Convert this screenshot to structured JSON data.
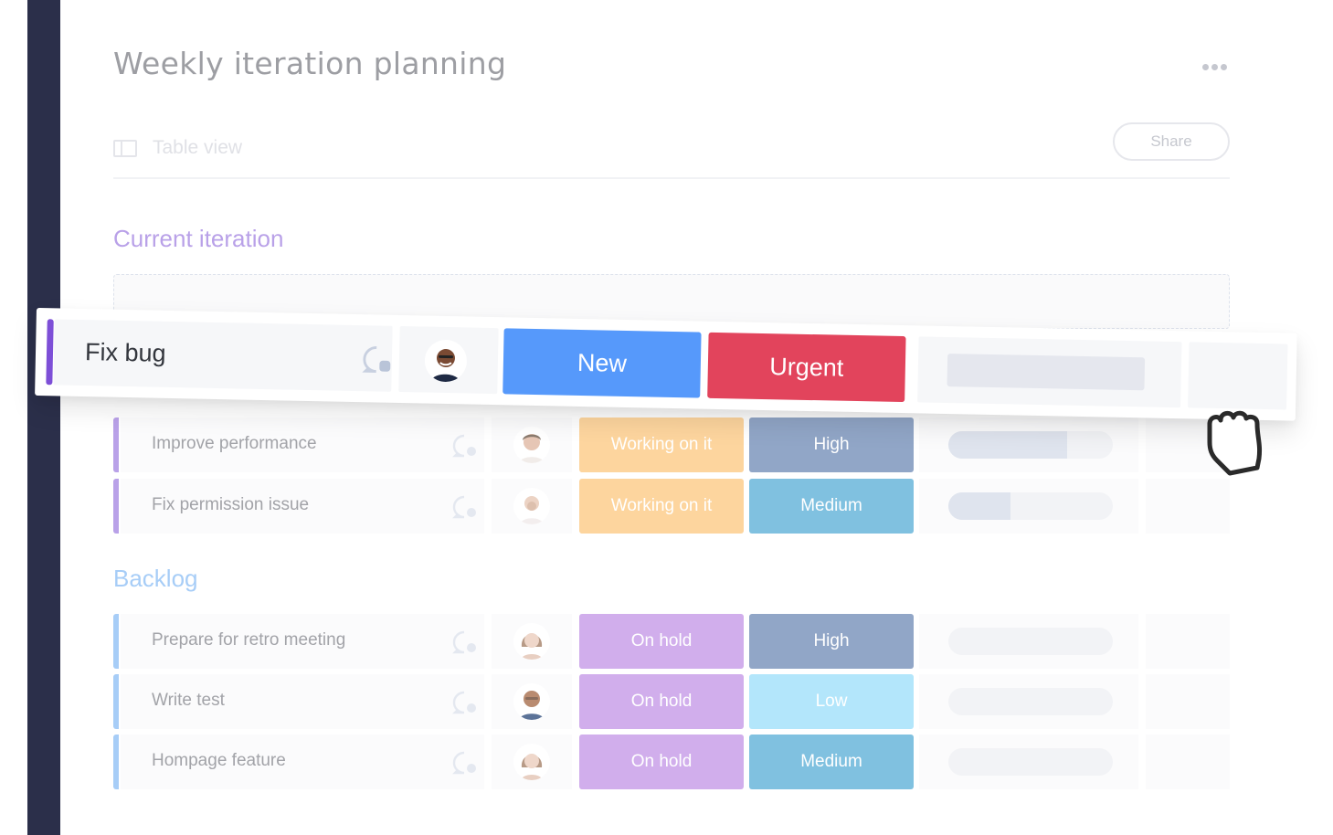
{
  "header": {
    "title": "Weekly iteration planning",
    "more_icon": "more-horizontal-icon",
    "view": {
      "icon": "table-view-icon",
      "label": "Table view"
    },
    "share_label": "Share"
  },
  "colors": {
    "sidebar": "#2b2f4a",
    "current_group": "#b9a1e8",
    "backlog_group": "#a7cdf7",
    "new": "#5699fb",
    "urgent": "#e2445c",
    "working_on_it": "#fdd59e",
    "on_hold": "#d1aeec",
    "high": "#91a6c7",
    "medium": "#80c1e0",
    "low": "#b3e6fb"
  },
  "dragged_item": {
    "name": "Fix bug",
    "comment_icon": "comment-icon",
    "person": "man-with-glasses",
    "status": "New",
    "priority": "Urgent",
    "progress": 0
  },
  "groups": [
    {
      "title": "Current iteration",
      "items": [
        {
          "name": "Improve performance",
          "person": "man-tousled-hair",
          "status": "Working on it",
          "priority": "High",
          "progress": 0.72
        },
        {
          "name": "Fix permission issue",
          "person": "bald-man-glasses",
          "status": "Working on it",
          "priority": "Medium",
          "progress": 0.38
        }
      ]
    },
    {
      "title": "Backlog",
      "items": [
        {
          "name": "Prepare for retro meeting",
          "person": "woman-brown-hair",
          "status": "On hold",
          "priority": "High",
          "progress": 0
        },
        {
          "name": "Write test",
          "person": "man-with-glasses",
          "status": "On hold",
          "priority": "Low",
          "progress": 0
        },
        {
          "name": "Hompage feature",
          "person": "woman-brown-hair",
          "status": "On hold",
          "priority": "Medium",
          "progress": 0
        }
      ]
    }
  ],
  "cursor": "grab-hand-icon"
}
